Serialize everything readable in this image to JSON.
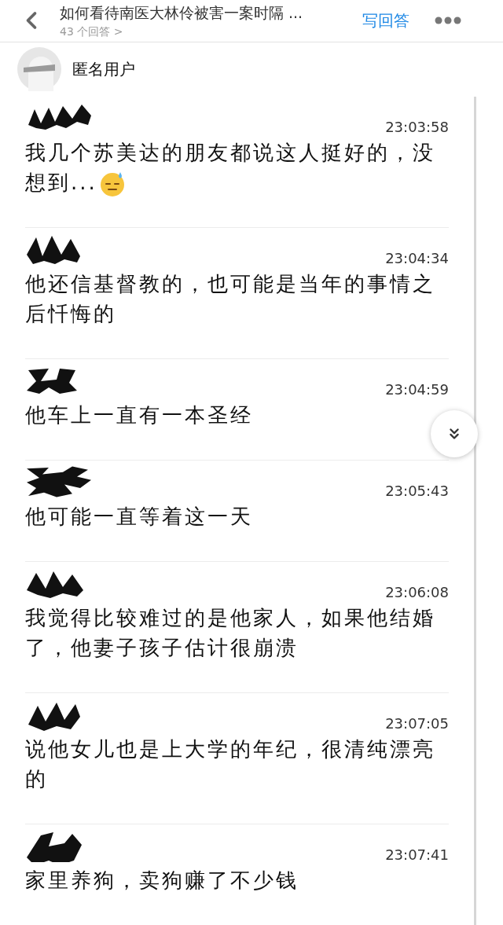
{
  "header": {
    "title": "如何看待南医大林伶被害一案时隔 ...",
    "answer_count": "43 个回答 >",
    "write_answer": "写回答"
  },
  "author": {
    "name": "匿名用户"
  },
  "messages": [
    {
      "time": "23:03:58",
      "text": "我几个苏美达的朋友都说这人挺好的，没想到...",
      "emoji": true
    },
    {
      "time": "23:04:34",
      "text": "他还信基督教的，也可能是当年的事情之后忏悔的",
      "emoji": false
    },
    {
      "time": "23:04:59",
      "text": "他车上一直有一本圣经",
      "emoji": false
    },
    {
      "time": "23:05:43",
      "text": "他可能一直等着这一天",
      "emoji": false
    },
    {
      "time": "23:06:08",
      "text": "我觉得比较难过的是他家人，如果他结婚了，他妻子孩子估计很崩溃",
      "emoji": false
    },
    {
      "time": "23:07:05",
      "text": "说他女儿也是上大学的年纪，很清纯漂亮的",
      "emoji": false
    },
    {
      "time": "23:07:41",
      "text": "家里养狗，卖狗赚了不少钱",
      "emoji": false
    }
  ]
}
